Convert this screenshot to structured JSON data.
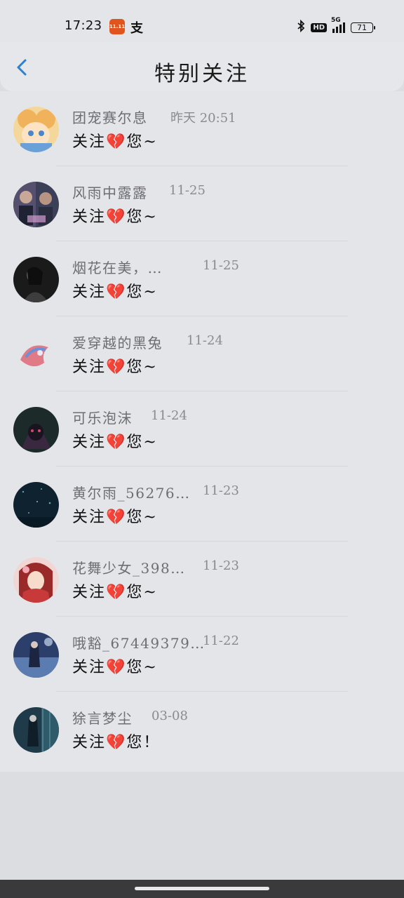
{
  "status_bar": {
    "time": "17:23",
    "app_icon_text": "11.11",
    "app_icon2": "支",
    "hd": "HD",
    "network": "5G",
    "battery": "71"
  },
  "header": {
    "title": "特别关注"
  },
  "items": [
    {
      "name": "团宠赛尔息",
      "date": "昨天 20:51",
      "message": "关注💔您~"
    },
    {
      "name": "风雨中露露",
      "date": "11-25",
      "message": "关注💔您~"
    },
    {
      "name": "烟花在美，…",
      "date": "11-25",
      "message": "关注💔您~"
    },
    {
      "name": "爱穿越的黑兔",
      "date": "11-24",
      "message": "关注💔您~"
    },
    {
      "name": "可乐泡沫",
      "date": "11-24",
      "message": "关注💔您~"
    },
    {
      "name": "黄尔雨_56276…",
      "date": "11-23",
      "message": "关注💔您~"
    },
    {
      "name": "花舞少女_398…",
      "date": "11-23",
      "message": "关注💔您~"
    },
    {
      "name": "哦豁_67449379…",
      "date": "11-22",
      "message": "关注💔您~"
    },
    {
      "name": "狳言梦尘",
      "date": "03-08",
      "message": "关注💔您！"
    }
  ],
  "colors": {
    "accent": "#2f7fd0",
    "background": "#e4e5e9"
  }
}
